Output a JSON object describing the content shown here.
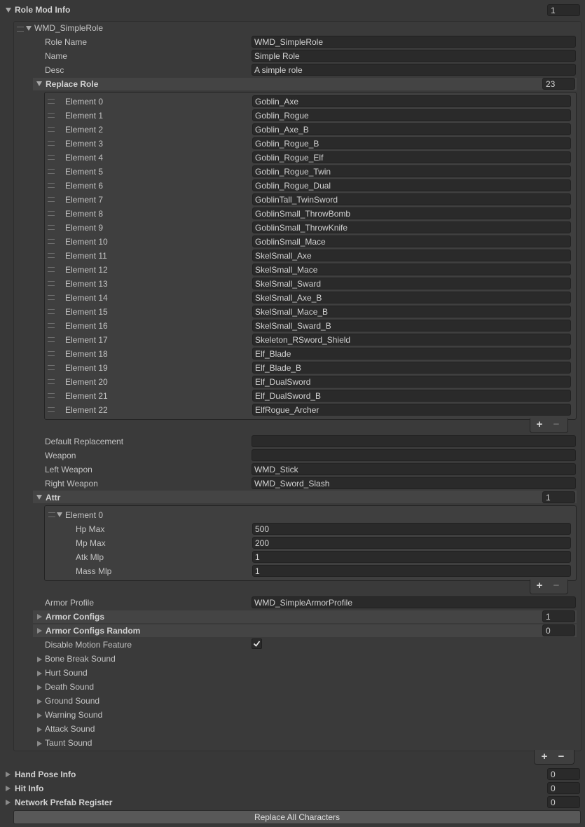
{
  "top": {
    "label": "Role Mod Info",
    "count": "1"
  },
  "item": {
    "title": "WMD_SimpleRole",
    "fields": [
      {
        "label": "Role Name",
        "value": "WMD_SimpleRole"
      },
      {
        "label": "Name",
        "value": "Simple Role"
      },
      {
        "label": "Desc",
        "value": "A simple role"
      }
    ],
    "replace_role": {
      "label": "Replace Role",
      "count": "23",
      "elements": [
        {
          "label": "Element 0",
          "value": "Goblin_Axe"
        },
        {
          "label": "Element 1",
          "value": "Goblin_Rogue"
        },
        {
          "label": "Element 2",
          "value": "Goblin_Axe_B"
        },
        {
          "label": "Element 3",
          "value": "Goblin_Rogue_B"
        },
        {
          "label": "Element 4",
          "value": "Goblin_Rogue_Elf"
        },
        {
          "label": "Element 5",
          "value": "Goblin_Rogue_Twin"
        },
        {
          "label": "Element 6",
          "value": "Goblin_Rogue_Dual"
        },
        {
          "label": "Element 7",
          "value": "GoblinTall_TwinSword"
        },
        {
          "label": "Element 8",
          "value": "GoblinSmall_ThrowBomb"
        },
        {
          "label": "Element 9",
          "value": "GoblinSmall_ThrowKnife"
        },
        {
          "label": "Element 10",
          "value": "GoblinSmall_Mace"
        },
        {
          "label": "Element 11",
          "value": "SkelSmall_Axe"
        },
        {
          "label": "Element 12",
          "value": "SkelSmall_Mace"
        },
        {
          "label": "Element 13",
          "value": "SkelSmall_Sward"
        },
        {
          "label": "Element 14",
          "value": "SkelSmall_Axe_B"
        },
        {
          "label": "Element 15",
          "value": "SkelSmall_Mace_B"
        },
        {
          "label": "Element 16",
          "value": "SkelSmall_Sward_B"
        },
        {
          "label": "Element 17",
          "value": "Skeleton_RSword_Shield"
        },
        {
          "label": "Element 18",
          "value": "Elf_Blade"
        },
        {
          "label": "Element 19",
          "value": "Elf_Blade_B"
        },
        {
          "label": "Element 20",
          "value": "Elf_DualSword"
        },
        {
          "label": "Element 21",
          "value": "Elf_DualSword_B"
        },
        {
          "label": "Element 22",
          "value": "ElfRogue_Archer"
        }
      ]
    },
    "weapon_fields": [
      {
        "label": "Default Replacement",
        "value": ""
      },
      {
        "label": "Weapon",
        "value": ""
      },
      {
        "label": "Left Weapon",
        "value": "WMD_Stick"
      },
      {
        "label": "Right Weapon",
        "value": "WMD_Sword_Slash"
      }
    ],
    "attr": {
      "label": "Attr",
      "count": "1",
      "element_label": "Element 0",
      "fields": [
        {
          "label": "Hp Max",
          "value": "500"
        },
        {
          "label": "Mp Max",
          "value": "200"
        },
        {
          "label": "Atk Mlp",
          "value": "1"
        },
        {
          "label": "Mass Mlp",
          "value": "1"
        }
      ]
    },
    "armor_profile": {
      "label": "Armor Profile",
      "value": "WMD_SimpleArmorProfile"
    },
    "armor_configs": {
      "label": "Armor Configs",
      "count": "1"
    },
    "armor_configs_random": {
      "label": "Armor Configs Random",
      "count": "0"
    },
    "disable_motion": {
      "label": "Disable Motion Feature",
      "checked": true
    },
    "sounds": [
      "Bone Break Sound",
      "Hurt Sound",
      "Death Sound",
      "Ground Sound",
      "Warning Sound",
      "Attack Sound",
      "Taunt Sound"
    ]
  },
  "bottom": [
    {
      "label": "Hand Pose Info",
      "count": "0"
    },
    {
      "label": "Hit Info",
      "count": "0"
    },
    {
      "label": "Network Prefab Register",
      "count": "0"
    }
  ],
  "replace_all_button": "Replace All Characters",
  "plus": "+",
  "minus": "−",
  "colors": {
    "background": "#383838",
    "field": "#2a2a2a",
    "text": "#c4c4c4",
    "button": "#585858"
  }
}
